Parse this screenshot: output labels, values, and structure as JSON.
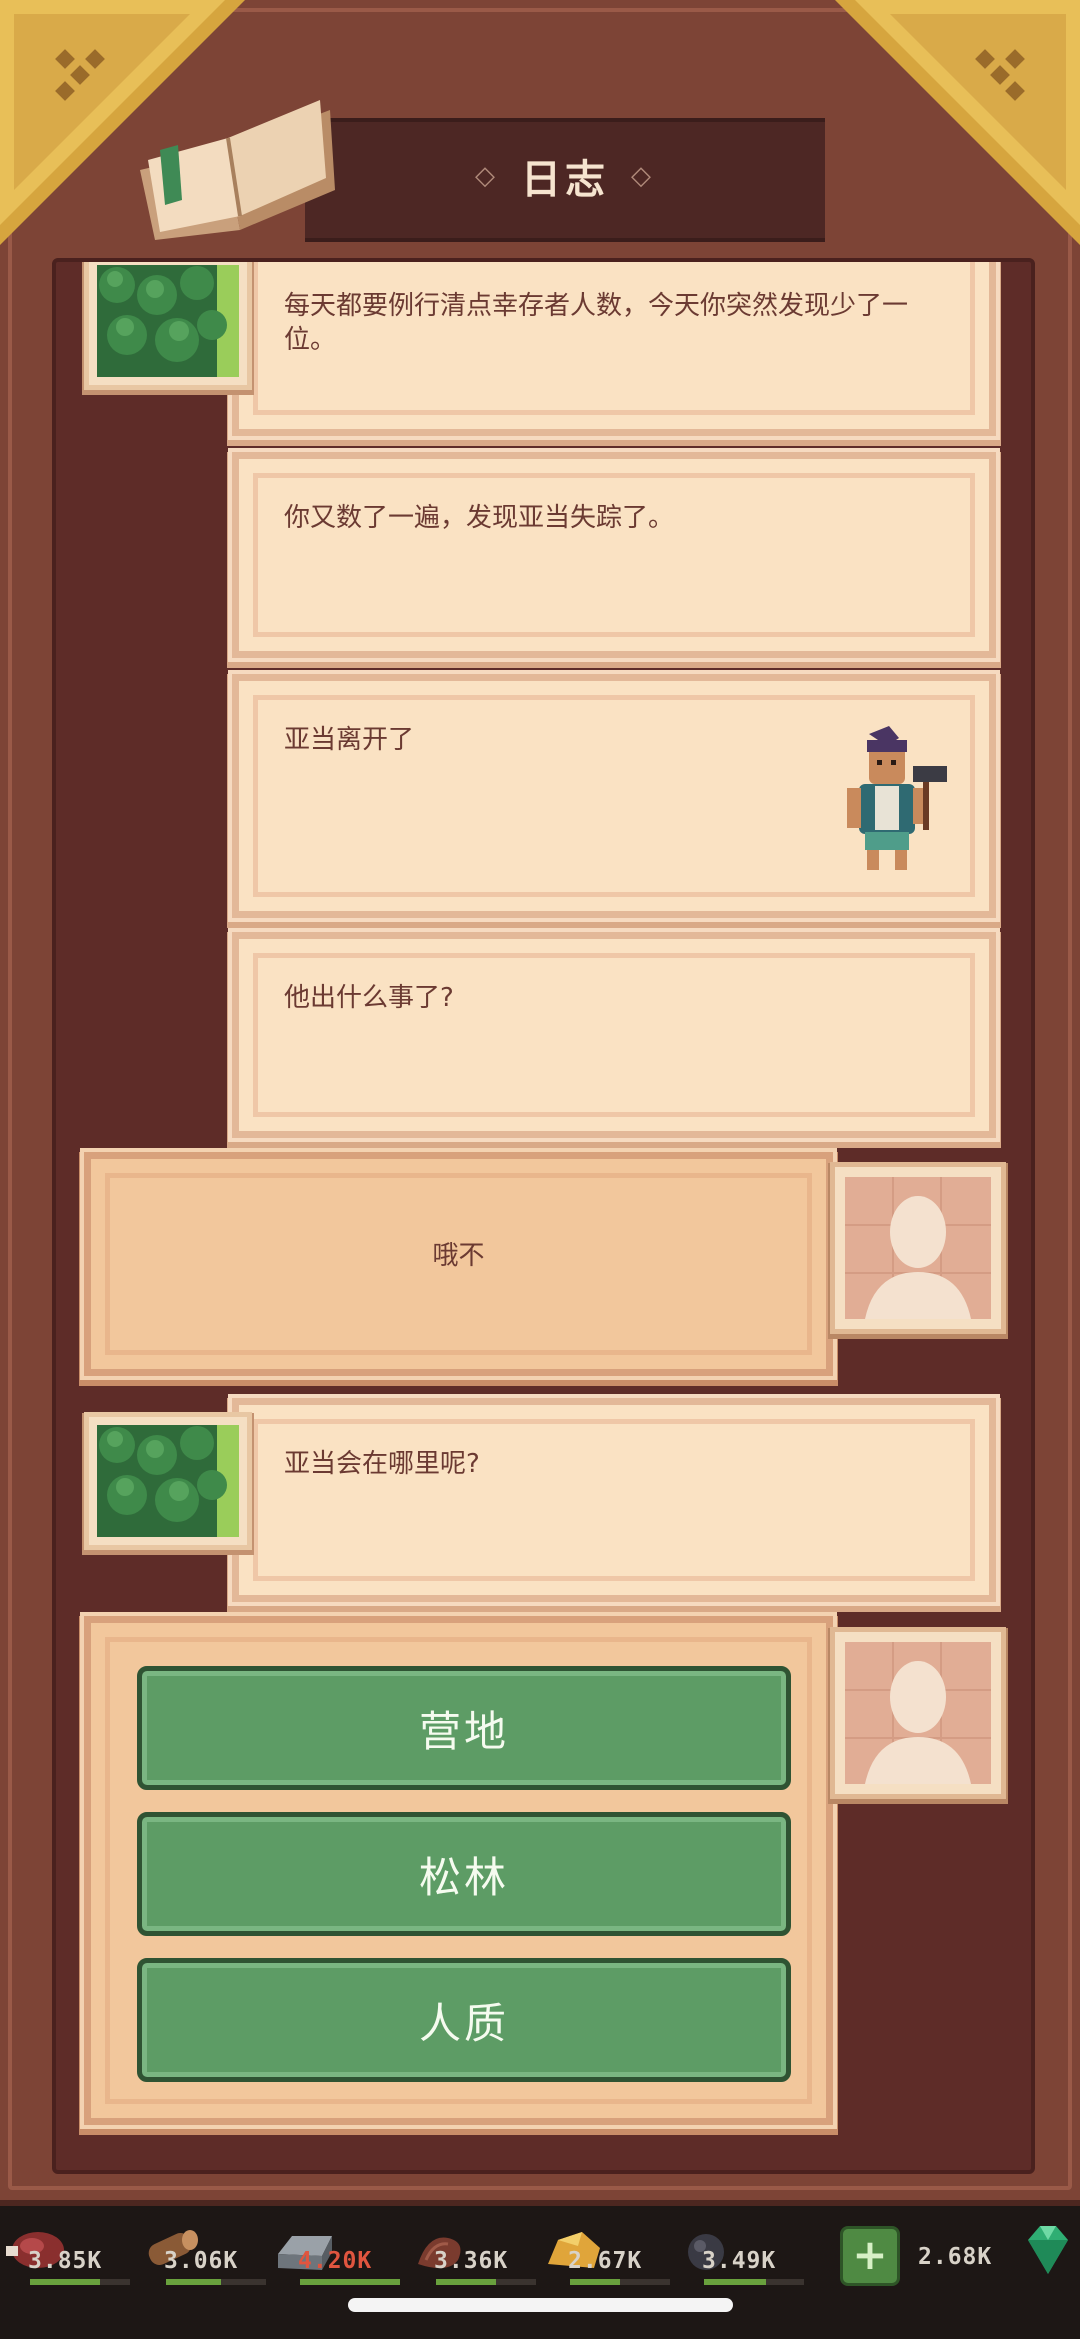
{
  "header": {
    "title": "日志"
  },
  "log_entries": [
    {
      "text": "每天都要例行清点幸存者人数，今天你突然发现少了一位。"
    },
    {
      "text": "你又数了一遍，发现亚当失踪了。"
    },
    {
      "text": "亚当离开了"
    },
    {
      "text": "他出什么事了?"
    },
    {
      "text": "哦不"
    },
    {
      "text": "亚当会在哪里呢?"
    }
  ],
  "choices": [
    {
      "label": "营地"
    },
    {
      "label": "松林"
    },
    {
      "label": "人质"
    }
  ],
  "resources": [
    {
      "icon": "meat-icon",
      "value": "3.85K",
      "fill": 0.7,
      "color": "#d8d2c8"
    },
    {
      "icon": "wood-log-icon",
      "value": "3.06K",
      "fill": 0.55,
      "color": "#d8d2c8"
    },
    {
      "icon": "iron-ingot-icon",
      "value": "4.20K",
      "fill": 1.0,
      "color": "#e0553f"
    },
    {
      "icon": "leather-icon",
      "value": "3.36K",
      "fill": 0.6,
      "color": "#d8d2c8"
    },
    {
      "icon": "gold-ore-icon",
      "value": "2.67K",
      "fill": 0.5,
      "color": "#d8d2c8"
    },
    {
      "icon": "coal-icon",
      "value": "3.49K",
      "fill": 0.62,
      "color": "#d8d2c8"
    }
  ],
  "gems": {
    "icon": "emerald-icon",
    "value": "2.68K",
    "add_icon": "plus-icon"
  },
  "colors": {
    "frame": "#7d4436",
    "panel": "#5e2c28",
    "card": "#fae2c3",
    "player_card": "#f2c79c",
    "choice": "#5d9c65"
  }
}
